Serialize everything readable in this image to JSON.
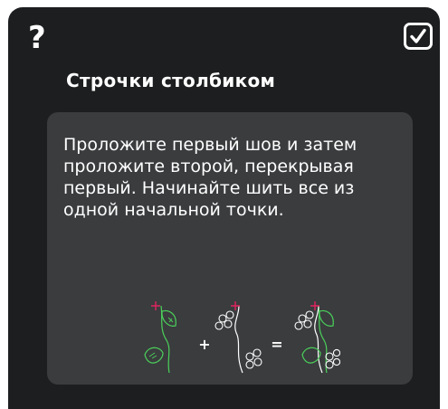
{
  "dialog": {
    "help_icon": "?",
    "confirm_icon": "checkmark-icon",
    "title": "Строчки столбиком",
    "body_text": "Проложите первый шов и затем проложите второй, перекрывая первый. Начинайте шить все из одной начальной точки.",
    "diagram": {
      "plus": "+",
      "equals": "=",
      "colors": {
        "panel": "#3a3c3e",
        "stitch_green": "#4bd15a",
        "stitch_white": "#ffffff",
        "start_marker": "#e0245e"
      }
    }
  }
}
